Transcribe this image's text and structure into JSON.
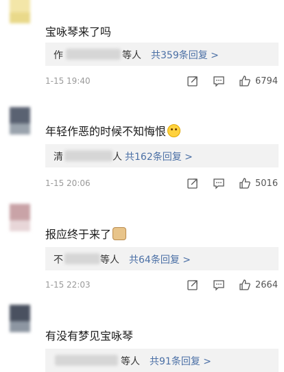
{
  "comments": [
    {
      "text": "宝咏琴来了吗",
      "reply_prefix": "作",
      "reply_suffix": "等人",
      "reply_count": "共359条回复 >",
      "time": "1-15 19:40",
      "likes": "6794"
    },
    {
      "text": "年轻作恶的时候不知悔恨",
      "reply_prefix": "清",
      "reply_suffix": "人",
      "reply_count": "共162条回复 >",
      "time": "1-15 20:06",
      "likes": "5016"
    },
    {
      "text": "报应终于来了",
      "reply_prefix": "不",
      "reply_suffix": "等人",
      "reply_count": "共64条回复 >",
      "time": "1-15 22:03",
      "likes": "2664"
    },
    {
      "text": "有没有梦见宝咏琴",
      "reply_prefix": "",
      "reply_suffix": "等人",
      "reply_count": "共91条回复 >",
      "time": "",
      "likes": ""
    }
  ],
  "icons": {
    "share": "share-icon",
    "comment": "comment-icon",
    "like": "thumbs-up-icon",
    "smile": "smile-emoji-icon",
    "doge": "doge-emoji-icon"
  },
  "colors": {
    "reply_bg": "#f2f2f2",
    "accent": "#4a6fa5",
    "meta": "#999999"
  }
}
